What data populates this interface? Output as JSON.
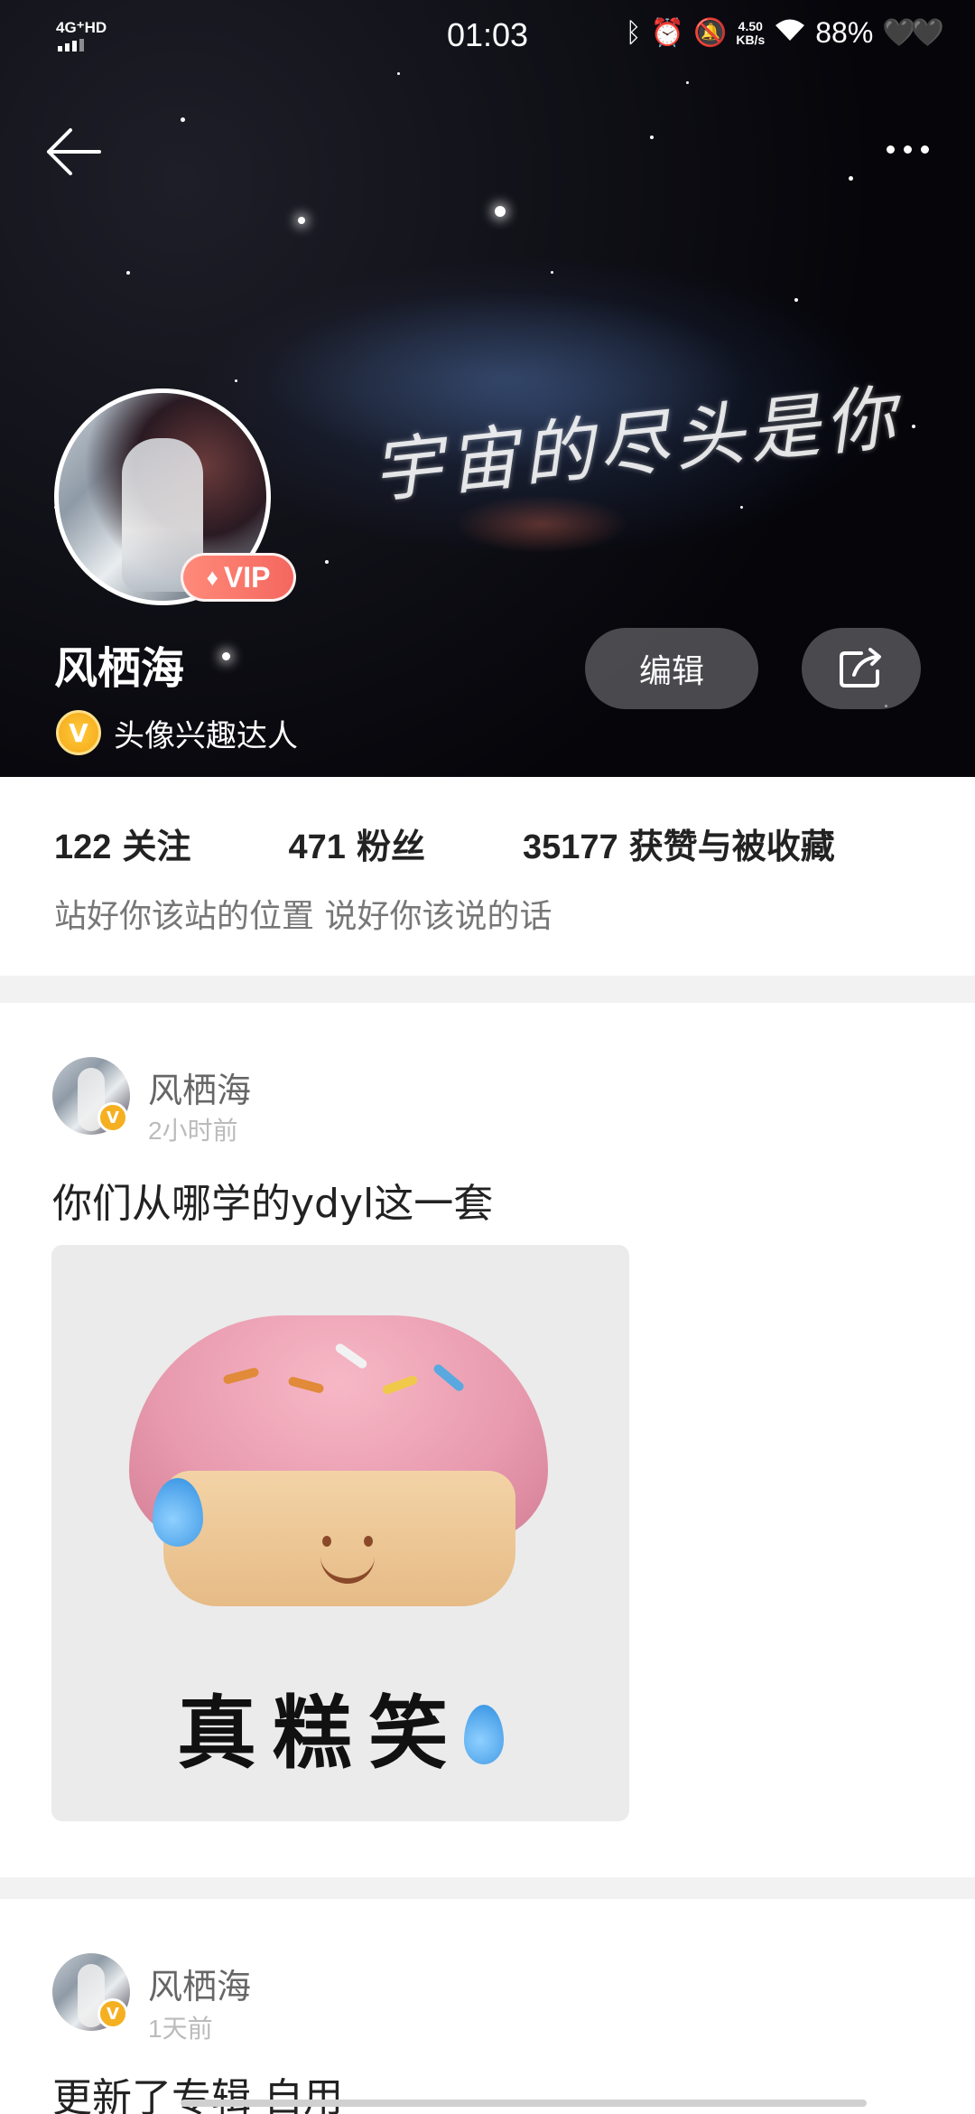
{
  "status_bar": {
    "network": "4G⁺HD",
    "time": "01:03",
    "speed_value": "4.50",
    "speed_unit": "KB/s",
    "battery": "88%"
  },
  "profile": {
    "name": "风栖海",
    "vip_label": "VIP",
    "badge_title": "头像兴趣达人",
    "edit_label": "编辑",
    "background_text": "宇宙的尽头是你",
    "stats": {
      "following_count": "122",
      "following_label": "关注",
      "followers_count": "471",
      "followers_label": "粉丝",
      "likes_count": "35177",
      "likes_label": "获赞与被收藏"
    },
    "bio": "站好你该站的位置 说好你该说的话"
  },
  "posts": [
    {
      "author": "风栖海",
      "time": "2小时前",
      "text": "你们从哪学的ydyl这一套",
      "image_caption": "真糕笑"
    },
    {
      "author": "风栖海",
      "time": "1天前",
      "text": "更新了专辑 自用"
    }
  ],
  "icons": {
    "back": "back-arrow-icon",
    "more": "more-dots-icon",
    "share": "share-icon",
    "verified": "verified-v-icon",
    "vip": "diamond-icon"
  },
  "colors": {
    "vip_badge": "#f4675e",
    "verified_gold": "#f5b021",
    "divider": "#f2f2f2"
  }
}
